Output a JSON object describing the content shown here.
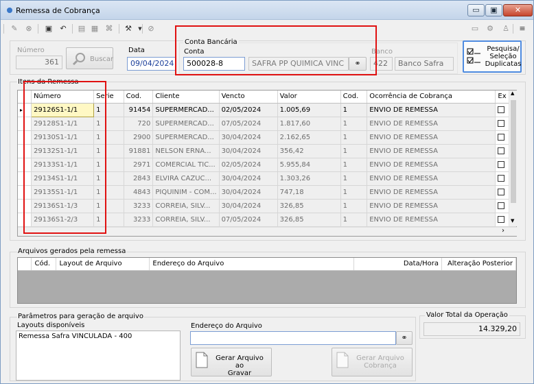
{
  "window": {
    "title": "Remessa de Cobrança",
    "min_label": "▭",
    "max_label": "▣",
    "close_label": "✕"
  },
  "toolbar": {
    "icons": [
      "edit-icon",
      "cancel-icon",
      "save-icon",
      "undo-icon",
      "print-icon",
      "export-icon",
      "attach-icon",
      "tools-icon",
      "block-icon",
      "display-icon",
      "settings-icon",
      "user-icon",
      "menu-icon"
    ]
  },
  "header": {
    "numero_label": "Número",
    "numero_value": "361",
    "buscar_label": "Buscar",
    "data_label": "Data",
    "data_value": "09/04/2024",
    "conta_group_label": "Conta Bancária",
    "conta_label": "Conta",
    "conta_value": "500028-8",
    "conta_desc": "SAFRA PP QUIMICA VINC",
    "banco_label": "Banco",
    "banco_code": "422",
    "banco_name": "Banco Safra",
    "pesquisa_label_1": "Pesquisa/",
    "pesquisa_label_2": "Seleção",
    "pesquisa_label_3": "Duplicatas"
  },
  "itens": {
    "group_label": "Itens da Remessa",
    "columns": [
      "Número",
      "Serie",
      "Cod.",
      "Cliente",
      "Vencto",
      "Valor",
      "Cod.",
      "Ocorrência de Cobrança",
      "Ex"
    ],
    "rows": [
      {
        "numero": "29126S1-1/1",
        "serie": "1",
        "cod": "91454",
        "cliente": "SUPERMERCAD...",
        "vencto": "02/05/2024",
        "valor": "1.005,69",
        "cod2": "1",
        "ocorrencia": "ENVIO DE REMESSA"
      },
      {
        "numero": "29128S1-1/1",
        "serie": "1",
        "cod": "720",
        "cliente": "SUPERMERCAD...",
        "vencto": "07/05/2024",
        "valor": "1.817,60",
        "cod2": "1",
        "ocorrencia": "ENVIO DE REMESSA"
      },
      {
        "numero": "29130S1-1/1",
        "serie": "1",
        "cod": "2900",
        "cliente": "SUPERMERCAD...",
        "vencto": "30/04/2024",
        "valor": "2.162,65",
        "cod2": "1",
        "ocorrencia": "ENVIO DE REMESSA"
      },
      {
        "numero": "29132S1-1/1",
        "serie": "1",
        "cod": "91881",
        "cliente": "NELSON ERNA...",
        "vencto": "30/04/2024",
        "valor": "356,42",
        "cod2": "1",
        "ocorrencia": "ENVIO DE REMESSA"
      },
      {
        "numero": "29133S1-1/1",
        "serie": "1",
        "cod": "2971",
        "cliente": "COMERCIAL TIC...",
        "vencto": "02/05/2024",
        "valor": "5.955,84",
        "cod2": "1",
        "ocorrencia": "ENVIO DE REMESSA"
      },
      {
        "numero": "29134S1-1/1",
        "serie": "1",
        "cod": "2843",
        "cliente": "ELVIRA CAZUC...",
        "vencto": "30/04/2024",
        "valor": "1.303,26",
        "cod2": "1",
        "ocorrencia": "ENVIO DE REMESSA"
      },
      {
        "numero": "29135S1-1/1",
        "serie": "1",
        "cod": "4843",
        "cliente": "PIQUINIM - COM...",
        "vencto": "30/04/2024",
        "valor": "747,18",
        "cod2": "1",
        "ocorrencia": "ENVIO DE REMESSA"
      },
      {
        "numero": "29136S1-1/3",
        "serie": "1",
        "cod": "3233",
        "cliente": "CORREIA, SILV...",
        "vencto": "30/04/2024",
        "valor": "326,85",
        "cod2": "1",
        "ocorrencia": "ENVIO DE REMESSA"
      },
      {
        "numero": "29136S1-2/3",
        "serie": "1",
        "cod": "3233",
        "cliente": "CORREIA, SILV...",
        "vencto": "07/05/2024",
        "valor": "326,85",
        "cod2": "1",
        "ocorrencia": "ENVIO DE REMESSA"
      }
    ]
  },
  "arquivos": {
    "group_label": "Arquivos gerados pela remessa",
    "columns": [
      "Cód.",
      "Layout de Arquivo",
      "Endereço do Arquivo",
      "Data/Hora",
      "Alteração Posterior"
    ]
  },
  "parametros": {
    "group_label": "Parâmetros para geração de arquivo",
    "layouts_label": "Layouts disponíveis",
    "layouts": [
      "Remessa Safra VINCULADA - 400"
    ],
    "endereco_label": "Endereço do Arquivo",
    "endereco_value": "",
    "gerar_label_1": "Gerar Arquivo ao",
    "gerar_label_2": "Gravar",
    "gerar_cobranca_1": "Gerar Arquivo",
    "gerar_cobranca_2": "Cobrança"
  },
  "total": {
    "label": "Valor Total da Operação",
    "value": "14.329,20"
  }
}
